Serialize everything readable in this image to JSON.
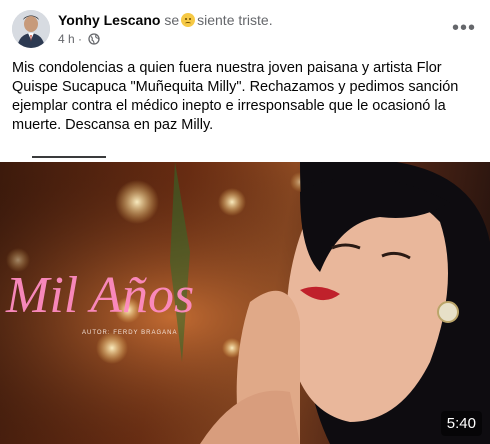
{
  "post": {
    "author": "Yonhy Lescano",
    "feeling_prefix": "se",
    "feeling_icon": "sad-face-emoji",
    "feeling_text": "siente triste.",
    "timestamp": "4 h",
    "separator": "·",
    "privacy_icon": "globe-icon",
    "more_icon": "ellipsis-icon",
    "more_label": "•••",
    "text_lines": [
      "Mis condolencias a quien fuera nuestra joven paisana y artista Flor",
      "Quispe Sucapuca \"Muñequita Milly\". Rechazamos y pedimos sanción",
      "ejemplar contra el  médico inepto e irresponsable que le ocasionó la",
      "muerte. Descansa en paz Milly."
    ]
  },
  "video": {
    "overlay_title": "Mil Años",
    "overlay_credit": "AUTOR: FERDY BRAGANA",
    "duration": "5:40"
  },
  "colors": {
    "meta": "#65676b",
    "neon": "#ff7bb5"
  }
}
